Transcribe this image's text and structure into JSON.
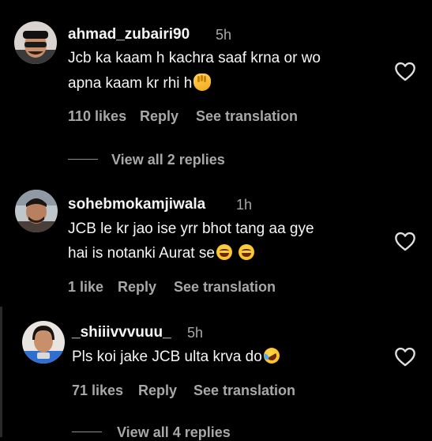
{
  "comments": [
    {
      "username": "ahmad_zubairi90",
      "time": "5h",
      "text_line1": "Jcb ka kaam h kachra saaf krna or wo",
      "text_line2": "apna kaam kr rhi h",
      "emoji": "clapping-hands",
      "likes": "110 likes",
      "reply": "Reply",
      "translation": "See translation",
      "view_replies": "View all 2 replies"
    },
    {
      "username": "sohebmokamjiwala",
      "time": "1h",
      "text_line1": "JCB le kr jao ise yrr bhot tang aa gye",
      "text_line2": "hai is notanki Aurat se",
      "emoji": "laughing-face",
      "likes": "1 like",
      "reply": "Reply",
      "translation": "See translation"
    },
    {
      "username": "_shiiivvvuuu_",
      "time": "5h",
      "text_line1": "Pls koi jake JCB ulta krva do",
      "emoji": "rolling-on-floor-laughing",
      "likes": "71 likes",
      "reply": "Reply",
      "translation": "See translation",
      "view_replies": "View all 4 replies"
    }
  ],
  "colors": {
    "background": "#000000",
    "primary_text": "#f5f5f5",
    "secondary_text": "#a8a8a8"
  }
}
